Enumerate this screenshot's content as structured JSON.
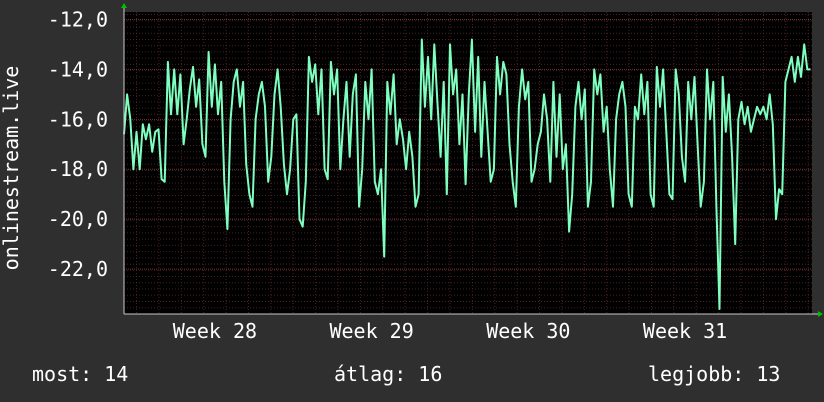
{
  "chart_data": {
    "type": "line",
    "title": "",
    "ylabel": "onlinestream.live",
    "xlabel": "",
    "ylim": [
      -23.8,
      -11.7
    ],
    "yticks": [
      -12.0,
      -14.0,
      -16.0,
      -18.0,
      -20.0,
      -22.0
    ],
    "ytick_labels": [
      "-12,0",
      "-14,0",
      "-16,0",
      "-18,0",
      "-20,0",
      "-22,0"
    ],
    "xlim": [
      27.42,
      31.81
    ],
    "xticks": [
      28,
      29,
      30,
      31
    ],
    "xtick_labels": [
      "Week 28",
      "Week 29",
      "Week 30",
      "Week 31"
    ],
    "grid": true,
    "colors": {
      "background": "#2f2f2f",
      "plot": "#000000",
      "line": "#7fffbf",
      "grid": "#5a2a2a",
      "axis_arrow": "#00c000"
    },
    "series": [
      {
        "values": [
          [
            27.42,
            -16.6
          ],
          [
            27.44,
            -15.0
          ],
          [
            27.46,
            -16.0
          ],
          [
            27.48,
            -18.0
          ],
          [
            27.5,
            -16.5
          ],
          [
            27.52,
            -18.0
          ],
          [
            27.54,
            -16.2
          ],
          [
            27.56,
            -16.8
          ],
          [
            27.58,
            -16.2
          ],
          [
            27.6,
            -17.3
          ],
          [
            27.62,
            -16.5
          ],
          [
            27.64,
            -16.4
          ],
          [
            27.66,
            -18.4
          ],
          [
            27.68,
            -18.5
          ],
          [
            27.7,
            -13.7
          ],
          [
            27.72,
            -15.8
          ],
          [
            27.74,
            -14.0
          ],
          [
            27.76,
            -15.8
          ],
          [
            27.78,
            -14.2
          ],
          [
            27.8,
            -17.0
          ],
          [
            27.82,
            -16.0
          ],
          [
            27.84,
            -14.8
          ],
          [
            27.86,
            -13.9
          ],
          [
            27.88,
            -15.5
          ],
          [
            27.9,
            -14.4
          ],
          [
            27.92,
            -17.0
          ],
          [
            27.94,
            -17.5
          ],
          [
            27.96,
            -13.3
          ],
          [
            27.98,
            -15.5
          ],
          [
            28.0,
            -13.8
          ],
          [
            28.02,
            -15.8
          ],
          [
            28.04,
            -14.5
          ],
          [
            28.06,
            -18.5
          ],
          [
            28.08,
            -20.4
          ],
          [
            28.1,
            -16.0
          ],
          [
            28.12,
            -14.5
          ],
          [
            28.14,
            -14.0
          ],
          [
            28.16,
            -15.5
          ],
          [
            28.18,
            -14.5
          ],
          [
            28.2,
            -17.8
          ],
          [
            28.22,
            -19.0
          ],
          [
            28.24,
            -19.5
          ],
          [
            28.26,
            -16.0
          ],
          [
            28.28,
            -15.0
          ],
          [
            28.3,
            -14.5
          ],
          [
            28.32,
            -15.5
          ],
          [
            28.34,
            -18.5
          ],
          [
            28.36,
            -17.5
          ],
          [
            28.38,
            -15.0
          ],
          [
            28.4,
            -14.0
          ],
          [
            28.42,
            -15.5
          ],
          [
            28.44,
            -17.8
          ],
          [
            28.46,
            -19.0
          ],
          [
            28.48,
            -18.0
          ],
          [
            28.5,
            -16.0
          ],
          [
            28.52,
            -15.8
          ],
          [
            28.54,
            -20.0
          ],
          [
            28.56,
            -20.3
          ],
          [
            28.58,
            -18.5
          ],
          [
            28.6,
            -13.5
          ],
          [
            28.62,
            -14.5
          ],
          [
            28.64,
            -13.8
          ],
          [
            28.66,
            -15.8
          ],
          [
            28.68,
            -14.0
          ],
          [
            28.7,
            -18.0
          ],
          [
            28.72,
            -18.4
          ],
          [
            28.74,
            -13.7
          ],
          [
            28.76,
            -15.0
          ],
          [
            28.78,
            -14.0
          ],
          [
            28.8,
            -18.0
          ],
          [
            28.82,
            -16.0
          ],
          [
            28.84,
            -14.5
          ],
          [
            28.86,
            -17.5
          ],
          [
            28.88,
            -15.0
          ],
          [
            28.9,
            -14.2
          ],
          [
            28.92,
            -19.5
          ],
          [
            28.94,
            -18.0
          ],
          [
            28.96,
            -14.5
          ],
          [
            28.98,
            -16.0
          ],
          [
            29.0,
            -14.0
          ],
          [
            29.02,
            -18.5
          ],
          [
            29.04,
            -19.0
          ],
          [
            29.06,
            -18.0
          ],
          [
            29.08,
            -21.5
          ],
          [
            29.1,
            -14.5
          ],
          [
            29.12,
            -15.8
          ],
          [
            29.14,
            -14.2
          ],
          [
            29.16,
            -17.0
          ],
          [
            29.18,
            -16.0
          ],
          [
            29.2,
            -16.8
          ],
          [
            29.22,
            -18.0
          ],
          [
            29.24,
            -16.5
          ],
          [
            29.26,
            -17.5
          ],
          [
            29.28,
            -19.5
          ],
          [
            29.3,
            -19.0
          ],
          [
            29.32,
            -12.8
          ],
          [
            29.34,
            -15.5
          ],
          [
            29.36,
            -13.5
          ],
          [
            29.38,
            -16.0
          ],
          [
            29.4,
            -13.0
          ],
          [
            29.42,
            -15.3
          ],
          [
            29.44,
            -17.5
          ],
          [
            29.46,
            -14.5
          ],
          [
            29.48,
            -19.0
          ],
          [
            29.5,
            -13.0
          ],
          [
            29.52,
            -15.0
          ],
          [
            29.54,
            -14.0
          ],
          [
            29.56,
            -17.0
          ],
          [
            29.58,
            -15.0
          ],
          [
            29.6,
            -18.6
          ],
          [
            29.62,
            -15.0
          ],
          [
            29.64,
            -12.8
          ],
          [
            29.66,
            -16.5
          ],
          [
            29.68,
            -13.5
          ],
          [
            29.7,
            -17.5
          ],
          [
            29.72,
            -14.5
          ],
          [
            29.74,
            -16.5
          ],
          [
            29.76,
            -18.5
          ],
          [
            29.78,
            -18.0
          ],
          [
            29.8,
            -13.5
          ],
          [
            29.82,
            -15.0
          ],
          [
            29.84,
            -13.7
          ],
          [
            29.86,
            -14.2
          ],
          [
            29.88,
            -17.0
          ],
          [
            29.9,
            -18.5
          ],
          [
            29.92,
            -19.5
          ],
          [
            29.94,
            -15.5
          ],
          [
            29.96,
            -14.0
          ],
          [
            29.98,
            -15.2
          ],
          [
            30.0,
            -14.5
          ],
          [
            30.02,
            -18.5
          ],
          [
            30.04,
            -18.0
          ],
          [
            30.06,
            -17.0
          ],
          [
            30.08,
            -16.5
          ],
          [
            30.1,
            -15.0
          ],
          [
            30.12,
            -16.0
          ],
          [
            30.14,
            -18.5
          ],
          [
            30.16,
            -14.5
          ],
          [
            30.18,
            -17.5
          ],
          [
            30.2,
            -15.0
          ],
          [
            30.22,
            -18.0
          ],
          [
            30.24,
            -17.0
          ],
          [
            30.26,
            -20.5
          ],
          [
            30.28,
            -19.0
          ],
          [
            30.3,
            -15.5
          ],
          [
            30.32,
            -14.5
          ],
          [
            30.34,
            -16.0
          ],
          [
            30.36,
            -14.8
          ],
          [
            30.38,
            -19.5
          ],
          [
            30.4,
            -18.5
          ],
          [
            30.42,
            -14.0
          ],
          [
            30.44,
            -15.0
          ],
          [
            30.46,
            -14.2
          ],
          [
            30.48,
            -16.5
          ],
          [
            30.5,
            -15.5
          ],
          [
            30.52,
            -18.0
          ],
          [
            30.54,
            -19.5
          ],
          [
            30.56,
            -16.0
          ],
          [
            30.58,
            -15.0
          ],
          [
            30.6,
            -14.5
          ],
          [
            30.62,
            -15.5
          ],
          [
            30.64,
            -19.0
          ],
          [
            30.66,
            -19.5
          ],
          [
            30.68,
            -15.5
          ],
          [
            30.7,
            -16.0
          ],
          [
            30.72,
            -14.2
          ],
          [
            30.74,
            -15.8
          ],
          [
            30.76,
            -14.5
          ],
          [
            30.78,
            -19.0
          ],
          [
            30.8,
            -19.5
          ],
          [
            30.82,
            -13.9
          ],
          [
            30.84,
            -15.5
          ],
          [
            30.86,
            -14.0
          ],
          [
            30.88,
            -16.5
          ],
          [
            30.9,
            -19.0
          ],
          [
            30.92,
            -19.2
          ],
          [
            30.94,
            -14.0
          ],
          [
            30.96,
            -15.0
          ],
          [
            30.98,
            -17.5
          ],
          [
            31.0,
            -18.5
          ],
          [
            31.02,
            -14.5
          ],
          [
            31.04,
            -16.0
          ],
          [
            31.06,
            -14.3
          ],
          [
            31.08,
            -17.0
          ],
          [
            31.1,
            -19.5
          ],
          [
            31.12,
            -18.5
          ],
          [
            31.14,
            -14.0
          ],
          [
            31.16,
            -16.0
          ],
          [
            31.18,
            -14.5
          ],
          [
            31.2,
            -19.5
          ],
          [
            31.22,
            -23.6
          ],
          [
            31.24,
            -14.3
          ],
          [
            31.26,
            -16.5
          ],
          [
            31.28,
            -15.0
          ],
          [
            31.3,
            -17.5
          ],
          [
            31.32,
            -21.0
          ],
          [
            31.34,
            -16.0
          ],
          [
            31.36,
            -15.3
          ],
          [
            31.38,
            -16.2
          ],
          [
            31.4,
            -15.5
          ],
          [
            31.42,
            -16.5
          ],
          [
            31.44,
            -16.0
          ],
          [
            31.46,
            -15.5
          ],
          [
            31.48,
            -15.8
          ],
          [
            31.5,
            -15.5
          ],
          [
            31.52,
            -16.0
          ],
          [
            31.54,
            -15.0
          ],
          [
            31.56,
            -16.2
          ],
          [
            31.58,
            -20.0
          ],
          [
            31.6,
            -18.8
          ],
          [
            31.62,
            -19.0
          ],
          [
            31.64,
            -14.5
          ],
          [
            31.66,
            -14.0
          ],
          [
            31.68,
            -13.5
          ],
          [
            31.7,
            -14.5
          ],
          [
            31.72,
            -13.5
          ],
          [
            31.74,
            -14.3
          ],
          [
            31.76,
            -13.0
          ],
          [
            31.78,
            -14.0
          ],
          [
            31.8,
            -14.0
          ]
        ]
      }
    ]
  },
  "stats": {
    "current": "most: 14",
    "average": "átlag: 16",
    "best": "legjobb: 13"
  }
}
